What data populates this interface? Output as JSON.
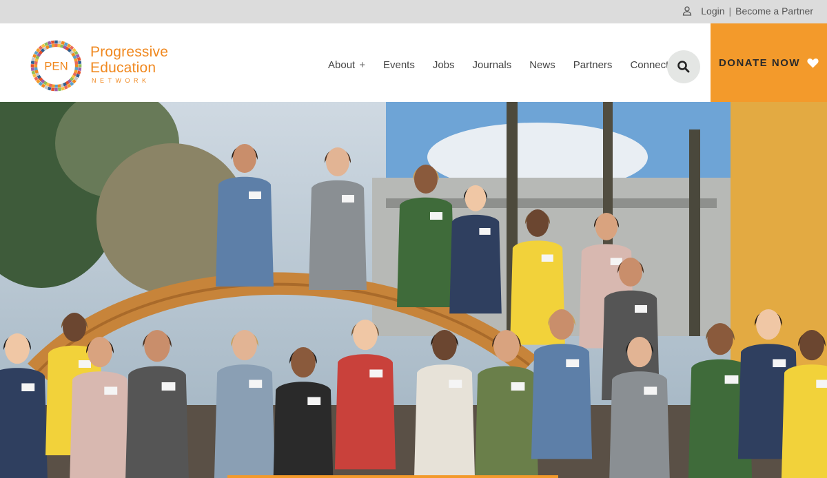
{
  "topbar": {
    "login": "Login",
    "separator": "|",
    "become_partner": "Become a Partner"
  },
  "logo": {
    "mark_text": "PEN",
    "line1": "Progressive",
    "line2": "Education",
    "line3": "NETWORK"
  },
  "nav": {
    "items": [
      {
        "label": "About",
        "has_submenu": true,
        "submenu_indicator": "+"
      },
      {
        "label": "Events"
      },
      {
        "label": "Jobs"
      },
      {
        "label": "Journals"
      },
      {
        "label": "News"
      },
      {
        "label": "Partners"
      },
      {
        "label": "Connect"
      }
    ]
  },
  "search": {
    "icon": "search-icon"
  },
  "donate": {
    "label": "DONATE NOW",
    "icon": "heart-icon"
  },
  "hero": {
    "image": "group-photo"
  },
  "colors": {
    "accent_orange": "#f39a2b",
    "logo_orange": "#f0881f",
    "topbar_bg": "#dcdcdc",
    "search_bg": "#e4e6e4"
  }
}
